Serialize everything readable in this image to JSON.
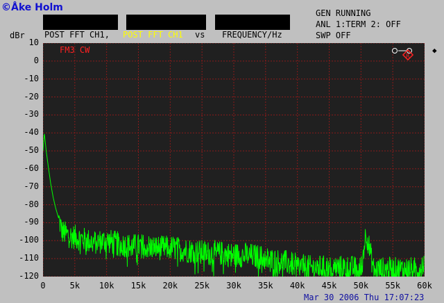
{
  "credit": "©Åke Holm",
  "header": {
    "channel_a": "POST FFT CH1,",
    "channel_b": "POST FFT CH1",
    "vs": "vs",
    "x_quantity": "FREQUENCY/Hz"
  },
  "status": {
    "line1": "GEN RUNNING",
    "line2": "ANL 1:TERM 2: OFF",
    "line3": "SWP OFF"
  },
  "y_unit": "dBr",
  "trace_label": "FM3 CW",
  "datetime": "Mar 30 2006 Thu 17:07:23",
  "colors": {
    "trace": "#00ff00",
    "plot_bg": "#202020",
    "grid": "#8b1a1a",
    "label": "#ff2020",
    "highlight": "#ffff00"
  },
  "chart_data": {
    "type": "line",
    "title": "",
    "xlabel": "FREQUENCY/Hz",
    "ylabel": "dBr",
    "xlim": [
      0,
      60000
    ],
    "ylim": [
      -120,
      10
    ],
    "grid": true,
    "x_ticks": [
      "0",
      "5k",
      "10k",
      "15k",
      "20k",
      "25k",
      "30k",
      "35k",
      "40k",
      "45k",
      "50k",
      "55k",
      "60k"
    ],
    "y_ticks": [
      "10",
      "0",
      "-10",
      "-20",
      "-30",
      "-40",
      "-50",
      "-60",
      "-70",
      "-80",
      "-90",
      "-100",
      "-110",
      "-120"
    ],
    "series": [
      {
        "name": "FM3 CW",
        "x": [
          0,
          200,
          500,
          800,
          1200,
          1600,
          2000,
          2500,
          3000,
          4000,
          5000,
          6000,
          7000,
          8000,
          10000,
          12000,
          14000,
          16000,
          18000,
          20000,
          22000,
          24000,
          26000,
          28000,
          30000,
          32000,
          34000,
          36000,
          38000,
          40000,
          42000,
          44000,
          46000,
          48000,
          50000,
          50800,
          52000,
          54000,
          56000,
          58000,
          59000,
          60000
        ],
        "y": [
          -50,
          -40,
          -50,
          -58,
          -68,
          -76,
          -82,
          -88,
          -95,
          -97,
          -98,
          -99,
          -100,
          -101,
          -100,
          -102,
          -103,
          -103,
          -104,
          -104,
          -105,
          -106,
          -107,
          -107,
          -108,
          -108,
          -109,
          -111,
          -112,
          -114,
          -115,
          -115,
          -115,
          -115,
          -116,
          -95,
          -116,
          -116,
          -116,
          -116,
          -116,
          -112
        ]
      }
    ]
  }
}
